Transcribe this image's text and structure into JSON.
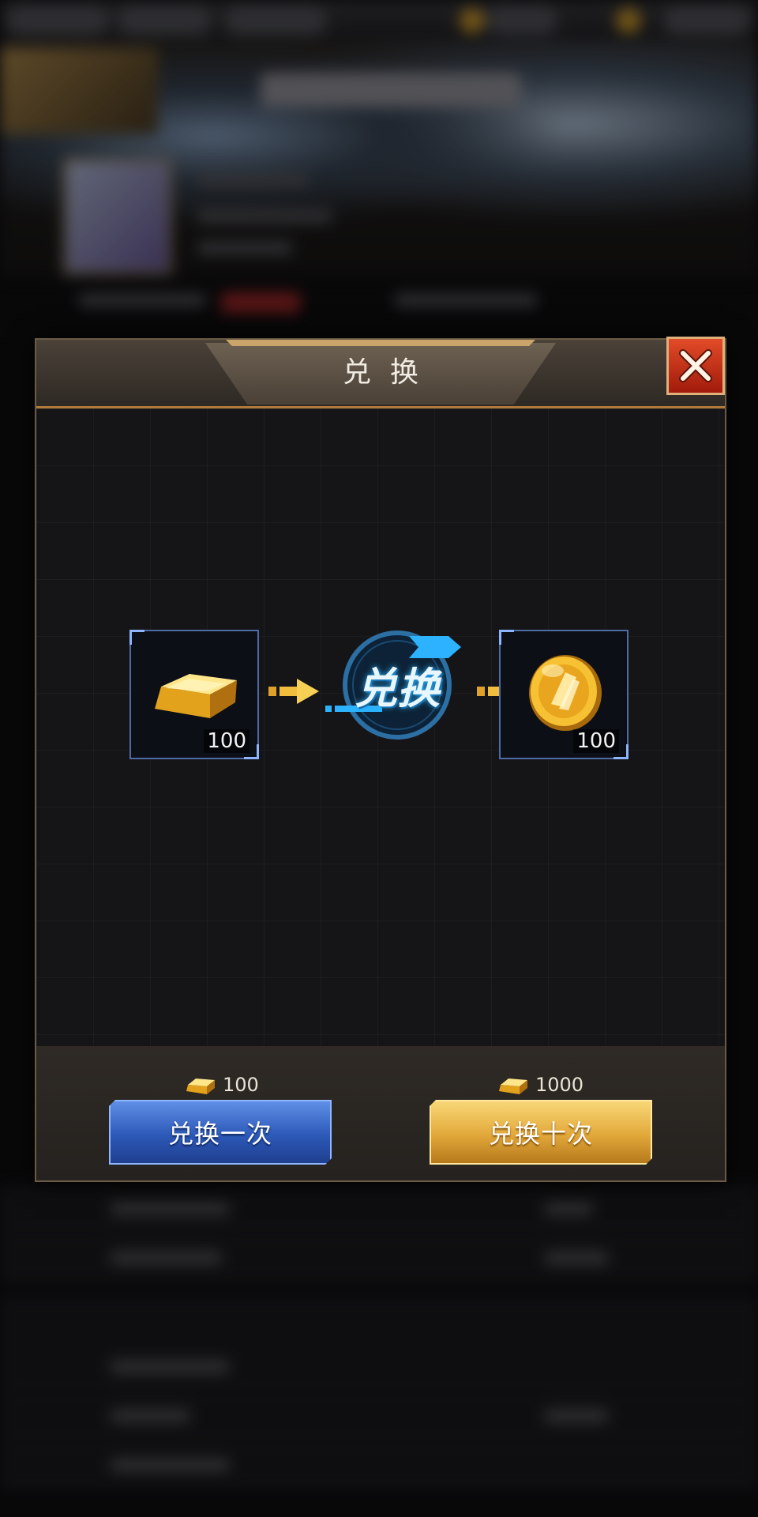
{
  "dialog": {
    "title": "兑换",
    "close_icon": "close-icon",
    "exchange_badge_label": "兑换"
  },
  "source_item": {
    "icon": "gold-bar-icon",
    "quantity": "100"
  },
  "target_item": {
    "icon": "gold-coin-icon",
    "quantity": "100"
  },
  "actions": {
    "once": {
      "cost": "100",
      "label": "兑换一次"
    },
    "ten": {
      "cost": "1000",
      "label": "兑换十次"
    }
  },
  "colors": {
    "header_accent": "#b07a3c",
    "close_red": "#c8301a",
    "button_blue": "#2d59b8",
    "button_gold": "#e2a83a",
    "slot_border": "#4e6ba4"
  }
}
